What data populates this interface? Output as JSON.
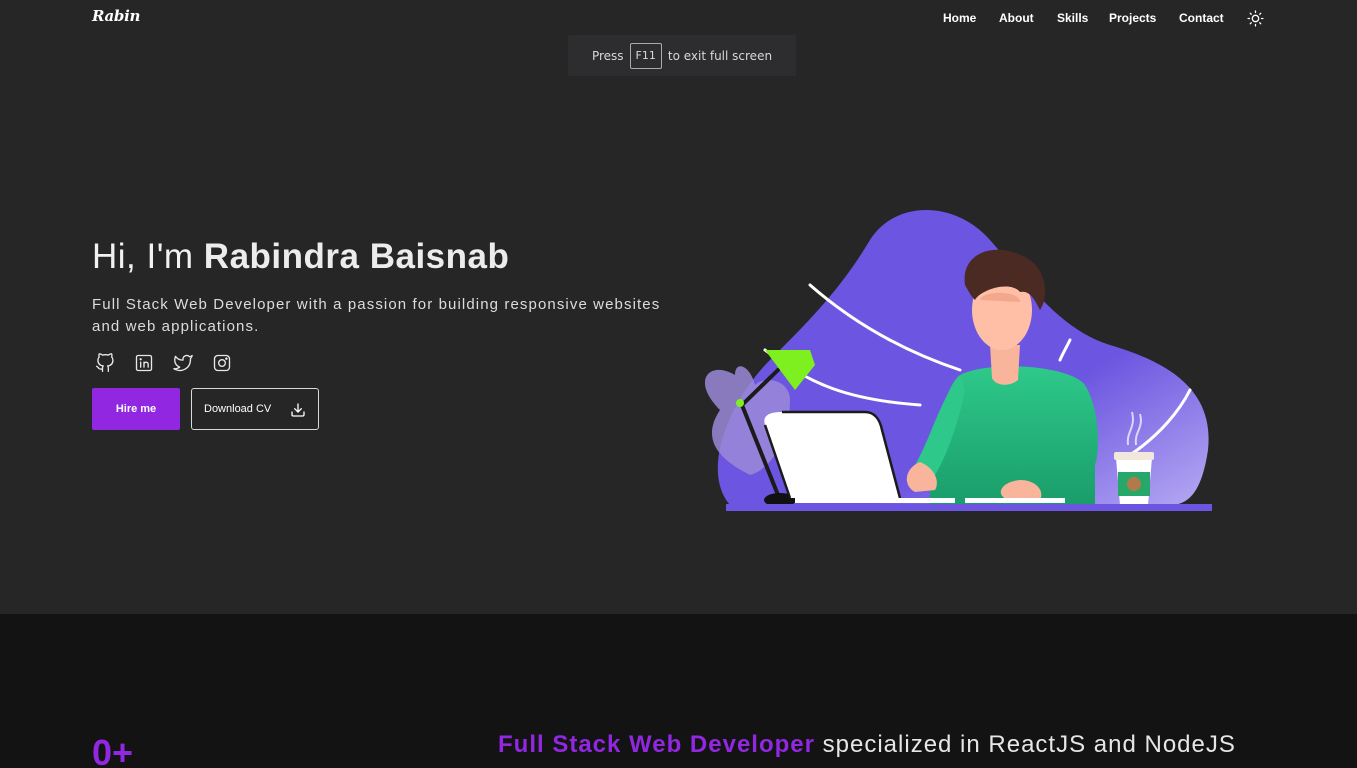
{
  "brand": {
    "logo": "Rabin"
  },
  "nav": {
    "items": [
      {
        "label": "Home"
      },
      {
        "label": "About"
      },
      {
        "label": "Skills"
      },
      {
        "label": "Projects"
      },
      {
        "label": "Contact"
      }
    ],
    "theme_toggle_icon": "sun-icon"
  },
  "toast": {
    "prefix": "Press",
    "key": "F11",
    "suffix": "to exit full screen"
  },
  "hero": {
    "greeting": "Hi, I'm",
    "name": "Rabindra Baisnab",
    "description": "Full Stack Web Developer with a passion for building responsive websites and web applications.",
    "socials": [
      {
        "icon": "github-icon"
      },
      {
        "icon": "linkedin-icon"
      },
      {
        "icon": "twitter-icon"
      },
      {
        "icon": "instagram-icon"
      }
    ],
    "hire_label": "Hire me",
    "cv_label": "Download CV",
    "cv_icon": "download-icon"
  },
  "about": {
    "stat_value": "0+",
    "tagline_accent": "Full Stack Web Developer",
    "tagline_rest": "specialized in ReactJS and NodeJS"
  },
  "colors": {
    "accent": "#9127e0",
    "background": "#262626",
    "section_background": "#131313",
    "illustration_blob": "#6c55e0"
  }
}
